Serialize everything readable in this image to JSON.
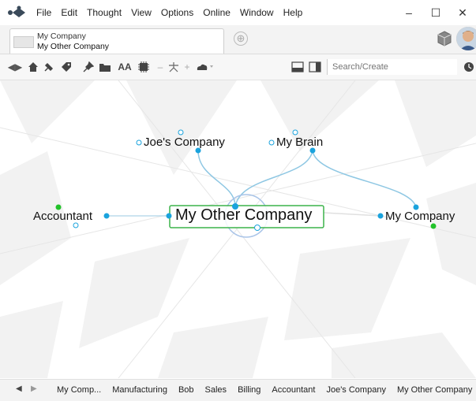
{
  "menu": [
    "File",
    "Edit",
    "Thought",
    "View",
    "Options",
    "Online",
    "Window",
    "Help"
  ],
  "window_controls": {
    "minimize": "–",
    "maximize": "☐",
    "close": "✕"
  },
  "tab": {
    "line1": "My Company",
    "line2": "My Other Company",
    "add": "⊕"
  },
  "search": {
    "placeholder": "Search/Create"
  },
  "toolbar": {
    "font_size_label": "AA"
  },
  "thoughts": {
    "active": "My Other Company",
    "parent_1": "Joe's Company",
    "parent_2": "My Brain",
    "jump": "Accountant",
    "sibling": "My Company"
  },
  "breadcrumbs": [
    "My Comp...",
    "Manufacturing",
    "Bob",
    "Sales",
    "Billing",
    "Accountant",
    "Joe's Company",
    "My Other Company"
  ],
  "colors": {
    "accent": "#1aa3dd",
    "active_border": "#3cb34a",
    "green_dot": "#22c22a"
  }
}
